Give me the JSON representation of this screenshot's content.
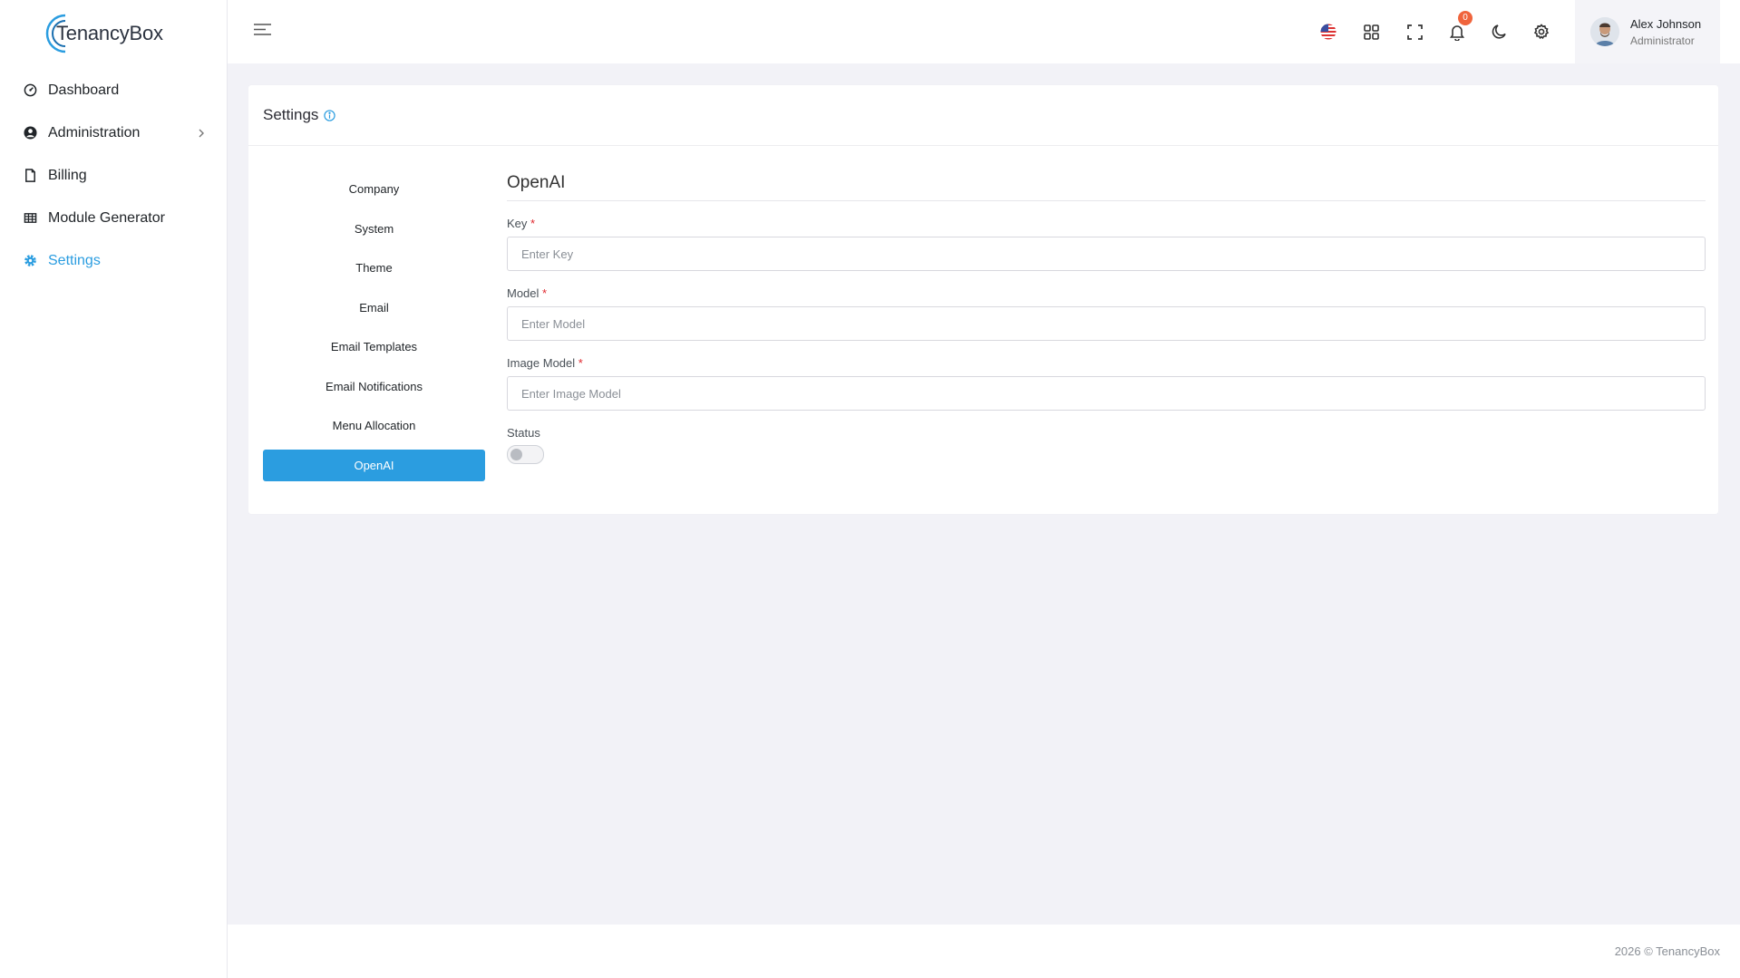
{
  "app": {
    "brand": "TenancyBox",
    "brand_color": "#2b9de0"
  },
  "sidebar": {
    "items": [
      {
        "label": "Dashboard",
        "icon": "gauge-icon"
      },
      {
        "label": "Administration",
        "icon": "user-circle-icon"
      },
      {
        "label": "Billing",
        "icon": "file-icon"
      },
      {
        "label": "Module Generator",
        "icon": "table-grid-icon"
      },
      {
        "label": "Settings",
        "icon": "gear-icon",
        "active": true
      }
    ]
  },
  "topbar": {
    "notification_count": "0",
    "user": {
      "name": "Alex Johnson",
      "role": "Administrator"
    }
  },
  "page": {
    "title": "Settings"
  },
  "tabs": [
    {
      "label": "Company"
    },
    {
      "label": "System"
    },
    {
      "label": "Theme"
    },
    {
      "label": "Email"
    },
    {
      "label": "Email Templates"
    },
    {
      "label": "Email Notifications"
    },
    {
      "label": "Menu Allocation"
    },
    {
      "label": "OpenAI",
      "active": true
    }
  ],
  "form": {
    "title": "OpenAI",
    "required_mark": "*",
    "key": {
      "label": "Key",
      "value": "",
      "placeholder": "Enter Key"
    },
    "model": {
      "label": "Model",
      "value": "",
      "placeholder": "Enter Model"
    },
    "image_model": {
      "label": "Image Model",
      "value": "",
      "placeholder": "Enter Image Model"
    },
    "status": {
      "label": "Status",
      "enabled": false
    }
  },
  "footer": {
    "text": "2026 © TenancyBox"
  }
}
